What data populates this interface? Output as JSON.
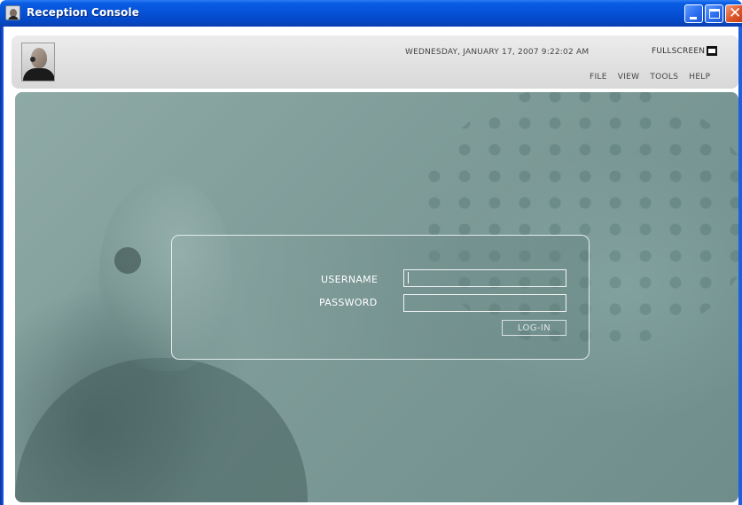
{
  "window": {
    "title": "Reception Console",
    "close_glyph": "✕",
    "icons": [
      "app-icon",
      "minimize-icon",
      "maximize-icon",
      "close-icon"
    ]
  },
  "header": {
    "datetime": "WEDNESDAY, JANUARY 17, 2007 9:22:02 AM",
    "fullscreen_label": "FULLSCREEN",
    "menu": [
      "FILE",
      "VIEW",
      "TOOLS",
      "HELP"
    ]
  },
  "login": {
    "username_label": "USERNAME",
    "password_label": "PASSWORD",
    "username_value": "",
    "password_value": "",
    "button_label": "LOG-IN"
  },
  "colors": {
    "titlebar": "#0552d8",
    "background": "#7f9c99",
    "panel_border": "#e2ecea"
  }
}
